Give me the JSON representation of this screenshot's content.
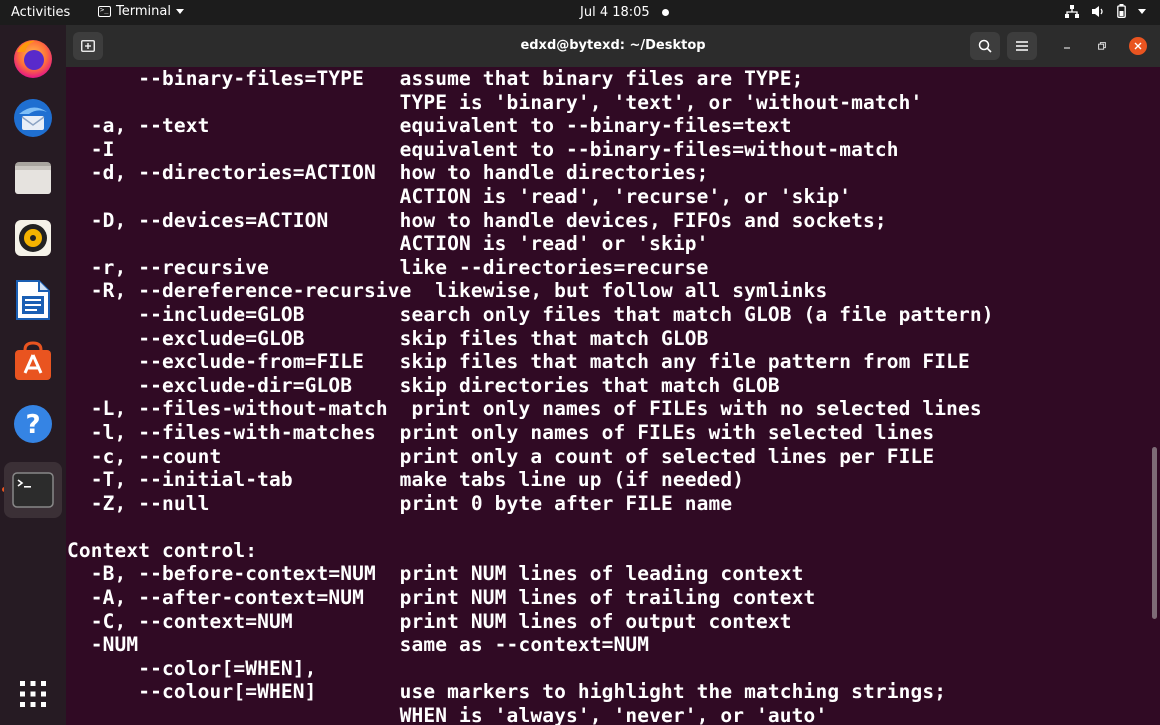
{
  "topbar": {
    "activities": "Activities",
    "app_name": "Terminal",
    "clock": "Jul 4  18:05"
  },
  "dock": {
    "items": [
      "firefox",
      "thunderbird",
      "files",
      "rhythmbox",
      "libreoffice-writer",
      "ubuntu-software",
      "help",
      "terminal",
      "show-applications"
    ]
  },
  "window": {
    "title": "edxd@bytexd: ~/Desktop"
  },
  "terminal": {
    "lines": [
      "      --binary-files=TYPE   assume that binary files are TYPE;",
      "                            TYPE is 'binary', 'text', or 'without-match'",
      "  -a, --text                equivalent to --binary-files=text",
      "  -I                        equivalent to --binary-files=without-match",
      "  -d, --directories=ACTION  how to handle directories;",
      "                            ACTION is 'read', 'recurse', or 'skip'",
      "  -D, --devices=ACTION      how to handle devices, FIFOs and sockets;",
      "                            ACTION is 'read' or 'skip'",
      "  -r, --recursive           like --directories=recurse",
      "  -R, --dereference-recursive  likewise, but follow all symlinks",
      "      --include=GLOB        search only files that match GLOB (a file pattern)",
      "      --exclude=GLOB        skip files that match GLOB",
      "      --exclude-from=FILE   skip files that match any file pattern from FILE",
      "      --exclude-dir=GLOB    skip directories that match GLOB",
      "  -L, --files-without-match  print only names of FILEs with no selected lines",
      "  -l, --files-with-matches  print only names of FILEs with selected lines",
      "  -c, --count               print only a count of selected lines per FILE",
      "  -T, --initial-tab         make tabs line up (if needed)",
      "  -Z, --null                print 0 byte after FILE name",
      "",
      "Context control:",
      "  -B, --before-context=NUM  print NUM lines of leading context",
      "  -A, --after-context=NUM   print NUM lines of trailing context",
      "  -C, --context=NUM         print NUM lines of output context",
      "  -NUM                      same as --context=NUM",
      "      --color[=WHEN],",
      "      --colour[=WHEN]       use markers to highlight the matching strings;",
      "                            WHEN is 'always', 'never', or 'auto'"
    ]
  },
  "colors": {
    "terminal_bg": "#300a24",
    "topbar_bg": "#1c1c1c",
    "dock_bg": "#261b23",
    "accent": "#e95420"
  }
}
